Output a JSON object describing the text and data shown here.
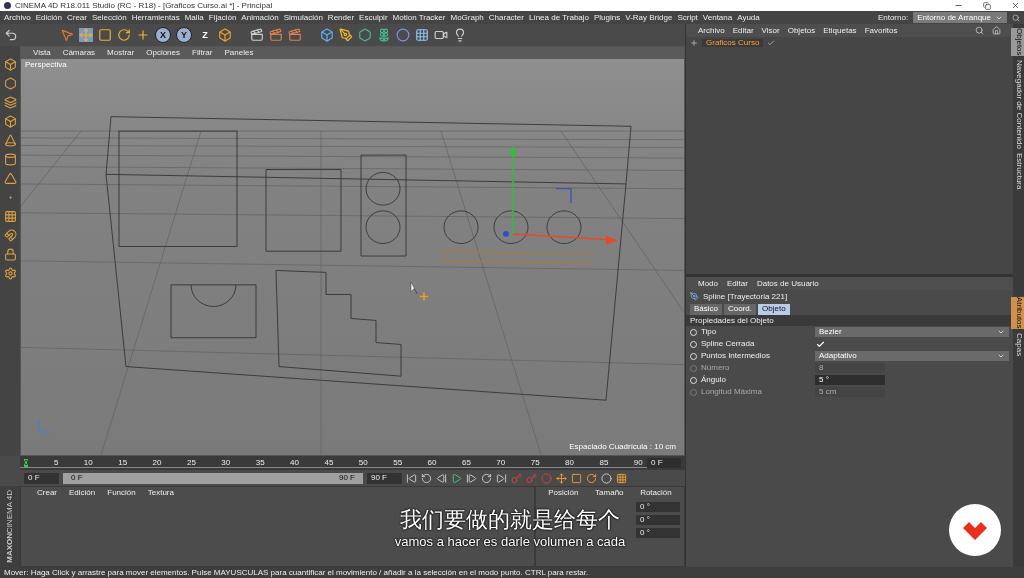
{
  "title_bar": {
    "title": "CINEMA 4D R18.011 Studio (RC - R18) - [Graficos Curso.ai *] - Principal"
  },
  "menu_bar": {
    "items": [
      "Archivo",
      "Edición",
      "Crear",
      "Selección",
      "Herramientas",
      "Malla",
      "Fijación",
      "Animación",
      "Simulación",
      "Render",
      "Esculpir",
      "Motion Tracker",
      "MoGraph",
      "Character",
      "Línea de Trabajo",
      "Plugins",
      "V-Ray Bridge",
      "Script",
      "Ventana",
      "Ayuda"
    ],
    "environment_label": "Entorno:",
    "environment_value": "Entorno de Arranque"
  },
  "toolbar": {
    "axes": [
      {
        "label": "X",
        "selected": true
      },
      {
        "label": "Y",
        "selected": true
      },
      {
        "label": "Z",
        "selected": false
      }
    ]
  },
  "viewport": {
    "menu": [
      "Vista",
      "Cámaras",
      "Mostrar",
      "Opciones",
      "Filtrar",
      "Paneles"
    ],
    "camera_label": "Perspectiva",
    "grid_spacing": "Espaciado Cuadrícula : 10 cm"
  },
  "timeline": {
    "ticks": [
      "0",
      "5",
      "10",
      "15",
      "20",
      "25",
      "30",
      "35",
      "40",
      "45",
      "50",
      "55",
      "60",
      "65",
      "70",
      "75",
      "80",
      "85",
      "90"
    ],
    "current_frame": "0 F",
    "start_field": "0 F",
    "range_start": "0 F",
    "range_end": "90 F",
    "end_field": "90 F"
  },
  "material_manager": {
    "menu": [
      "Crear",
      "Edición",
      "Función",
      "Textura"
    ]
  },
  "coordinates": {
    "columns": [
      "Posición",
      "Tamaño",
      "Rotación"
    ],
    "rotation_values": [
      "0 °",
      "0 °",
      "0 °"
    ]
  },
  "brand": {
    "line_1": "MAXON",
    "line_2": "CINEMA 4D"
  },
  "object_manager": {
    "menu": [
      "Archivo",
      "Editar",
      "Visor",
      "Objetos",
      "Etiquetas",
      "Favoritos"
    ],
    "objects": [
      {
        "name": "Graficos Curso",
        "selected": true
      }
    ]
  },
  "attributes": {
    "menu": [
      "Modo",
      "Editar",
      "Datos de Usuario"
    ],
    "object_title": "Spline [Trayectoria 221]",
    "tabs": [
      {
        "label": "Básico",
        "selected": false
      },
      {
        "label": "Coord.",
        "selected": false
      },
      {
        "label": "Objeto",
        "selected": true
      }
    ],
    "section": "Propiedades del Objeto",
    "properties": [
      {
        "kind": "dropdown",
        "label": "Tipo",
        "value": "Bezier",
        "disabled": false
      },
      {
        "kind": "checkbox",
        "label": "Spline Cerrada",
        "checked": true,
        "disabled": false
      },
      {
        "kind": "dropdown",
        "label": "Puntos Intermedios",
        "value": "Adaptativo",
        "disabled": false
      },
      {
        "kind": "number",
        "label": "Número",
        "value": "8",
        "disabled": true
      },
      {
        "kind": "number",
        "label": "Ángulo",
        "value": "5 °",
        "disabled": false
      },
      {
        "kind": "number",
        "label": "Longitud Máxima",
        "value": "5 cm",
        "disabled": true
      }
    ]
  },
  "side_tabs_top": [
    {
      "label": "Objetos",
      "selected": true
    },
    {
      "label": "Navegador de Contenido",
      "selected": false
    },
    {
      "label": "Estructura",
      "selected": false
    }
  ],
  "side_tabs_bottom": [
    {
      "label": "Atributos",
      "selected": true
    },
    {
      "label": "Capas",
      "selected": false
    }
  ],
  "status_bar": {
    "text": "Mover: Haga Click y arrastre para mover elementos. Pulse MAYUSCULAS para cuantificar el movimiento / añadir a la selección en el modo punto. CTRL para restar."
  },
  "subtitles": {
    "primary": "我们要做的就是给每个",
    "secondary": "vamos a hacer es darle volumen a cada"
  }
}
